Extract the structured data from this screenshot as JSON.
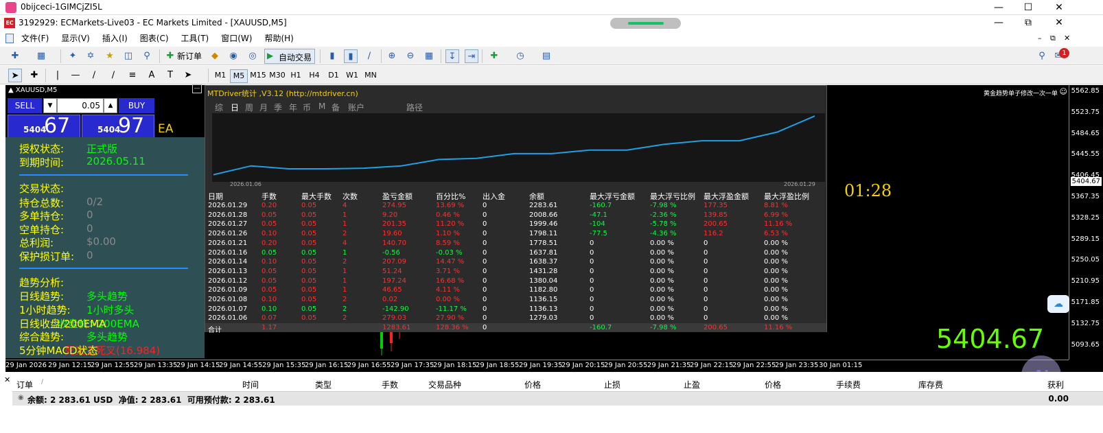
{
  "outer_window": {
    "title": "0bijceci-1GIMCjZI5L"
  },
  "app_window": {
    "title": "3192929: ECMarkets-Live03 - EC Markets Limited - [XAUUSD,M5]",
    "logo": "EC"
  },
  "menu": [
    "文件(F)",
    "显示(V)",
    "插入(I)",
    "图表(C)",
    "工具(T)",
    "窗口(W)",
    "帮助(H)"
  ],
  "toolbar": {
    "new_order": "新订单",
    "auto_trade": "自动交易",
    "notif_count": "1"
  },
  "timeframes": [
    "M1",
    "M5",
    "M15",
    "M30",
    "H1",
    "H4",
    "D1",
    "W1",
    "MN"
  ],
  "chart": {
    "symbol": "XAUUSD,M5",
    "right_note": "黄金趋势单子修改一次一单",
    "timer": "01:28",
    "big_price": "5404.67",
    "current_price_tag": "5404.67",
    "price_labels": [
      "5562.85",
      "5523.75",
      "5484.65",
      "5445.55",
      "5406.45",
      "5367.35",
      "5328.25",
      "5289.15",
      "5250.05",
      "5210.95",
      "5171.85",
      "5132.75",
      "5093.65"
    ],
    "time_labels": [
      "29 Jan 2026",
      "29 Jan 12:15",
      "29 Jan 12:55",
      "29 Jan 13:35",
      "29 Jan 14:15",
      "29 Jan 14:55",
      "29 Jan 15:35",
      "29 Jan 16:15",
      "29 Jan 16:55",
      "29 Jan 17:35",
      "29 Jan 18:15",
      "29 Jan 18:55",
      "29 Jan 19:35",
      "29 Jan 20:15",
      "29 Jan 20:55",
      "29 Jan 21:35",
      "29 Jan 22:15",
      "29 Jan 22:55",
      "29 Jan 23:35",
      "30 Jan 01:15"
    ]
  },
  "one_click": {
    "sell": "SELL",
    "buy": "BUY",
    "lot": "0.05",
    "sell_big": "5404",
    "sell_small": "67",
    "buy_big": "5404",
    "buy_small": "97",
    "ea_tag": "EA"
  },
  "ea_panel": {
    "auth_label": "授权状态:",
    "auth_value": "正式版",
    "expiry_label": "到期时间:",
    "expiry_value": "2026.05.11",
    "trade_header": "交易状态:",
    "positions_label": "持仓总数:",
    "positions_value": "0/2",
    "long_label": "多单持仓:",
    "long_value": "0",
    "short_label": "空单持仓:",
    "short_value": "0",
    "profit_label": "总利润:",
    "profit_value": "$0.00",
    "sl_label": "保护损订单:",
    "sl_value": "0",
    "trend_header": "趋势分析:",
    "daily_label": "日线趋势:",
    "daily_value": "多头趋势",
    "h1_label": "1小时趋势:",
    "h1_value": "1小时多头",
    "ema_label": "日线收盘/200EMA",
    "ema_value": "收盘价>200EMA",
    "overall_label": "综合趋势:",
    "overall_value": "多头趋势",
    "macd_label": "5分钟MACD状态",
    "macd_value": "死叉上死叉(16.984)"
  },
  "stats": {
    "title": "MTDriver统计 ,V3.12 (http://mtdriver.cn)",
    "tabs": [
      "综",
      "日",
      "周",
      "月",
      "季",
      "年",
      "币",
      "M",
      "备",
      "账户",
      "路径"
    ],
    "curve_start": "2026.01.06",
    "curve_end": "2026.01.29",
    "curve_balance": [
      1279.03,
      1430,
      1380,
      1380,
      1390,
      1430,
      1540,
      1560,
      1640,
      1640,
      1700,
      1700,
      1800,
      1860,
      1860,
      2008.66,
      2283.61
    ],
    "headers": [
      "日期",
      "手数",
      "最大手数",
      "次数",
      "盈亏金额",
      "百分比%",
      "出入金",
      "余额",
      "最大浮亏金额",
      "最大浮亏比例",
      "最大浮盈金额",
      "最大浮盈比例"
    ],
    "rows": [
      [
        "2026.01.29",
        "0.20",
        "0.05",
        "4",
        "274.95",
        "13.69 %",
        "0",
        "2283.61",
        "-160.7",
        "-7.98 %",
        "177.35",
        "8.81 %"
      ],
      [
        "2026.01.28",
        "0.05",
        "0.05",
        "1",
        "9.20",
        "0.46 %",
        "0",
        "2008.66",
        "-47.1",
        "-2.36 %",
        "139.85",
        "6.99 %"
      ],
      [
        "2026.01.27",
        "0.05",
        "0.05",
        "1",
        "201.35",
        "11.20 %",
        "0",
        "1999.46",
        "-104",
        "-5.78 %",
        "200.65",
        "11.16 %"
      ],
      [
        "2026.01.26",
        "0.10",
        "0.05",
        "2",
        "19.60",
        "1.10 %",
        "0",
        "1798.11",
        "-77.5",
        "-4.36 %",
        "116.2",
        "6.53 %"
      ],
      [
        "2026.01.21",
        "0.20",
        "0.05",
        "4",
        "140.70",
        "8.59 %",
        "0",
        "1778.51",
        "0",
        "0.00 %",
        "0",
        "0.00 %"
      ],
      [
        "2026.01.16",
        "0.05",
        "0.05",
        "1",
        "-0.56",
        "-0.03 %",
        "0",
        "1637.81",
        "0",
        "0.00 %",
        "0",
        "0.00 %"
      ],
      [
        "2026.01.14",
        "0.10",
        "0.05",
        "2",
        "207.09",
        "14.47 %",
        "0",
        "1638.37",
        "0",
        "0.00 %",
        "0",
        "0.00 %"
      ],
      [
        "2026.01.13",
        "0.05",
        "0.05",
        "1",
        "51.24",
        "3.71 %",
        "0",
        "1431.28",
        "0",
        "0.00 %",
        "0",
        "0.00 %"
      ],
      [
        "2026.01.12",
        "0.05",
        "0.05",
        "1",
        "197.24",
        "16.68 %",
        "0",
        "1380.04",
        "0",
        "0.00 %",
        "0",
        "0.00 %"
      ],
      [
        "2026.01.09",
        "0.05",
        "0.05",
        "1",
        "46.65",
        "4.11 %",
        "0",
        "1182.80",
        "0",
        "0.00 %",
        "0",
        "0.00 %"
      ],
      [
        "2026.01.08",
        "0.10",
        "0.05",
        "2",
        "0.02",
        "0.00 %",
        "0",
        "1136.15",
        "0",
        "0.00 %",
        "0",
        "0.00 %"
      ],
      [
        "2026.01.07",
        "0.10",
        "0.05",
        "2",
        "-142.90",
        "-11.17 %",
        "0",
        "1136.13",
        "0",
        "0.00 %",
        "0",
        "0.00 %"
      ],
      [
        "2026.01.06",
        "0.07",
        "0.05",
        "2",
        "279.03",
        "27.90 %",
        "0",
        "1279.03",
        "0",
        "0.00 %",
        "0",
        "0.00 %"
      ]
    ],
    "total": [
      "合计",
      "1.17",
      "",
      "",
      "1283.61",
      "128.36 %",
      "0",
      "",
      "-160.7",
      "-7.98 %",
      "200.65",
      "11.16 %"
    ],
    "colors": {
      "positive": "#ff3030",
      "negative": "#00ff40",
      "neutral": "#ffffff",
      "curve": "#1ea0e6"
    }
  },
  "terminal": {
    "columns": [
      "订单",
      "/",
      "时间",
      "类型",
      "手数",
      "交易品种",
      "价格",
      "止损",
      "止盈",
      "价格",
      "手续费",
      "库存费",
      "获利"
    ],
    "balance_line": "余额: 2 283.61 USD  净值: 2 283.61  可用预付款: 2 283.61",
    "balance_profit": "0.00"
  }
}
